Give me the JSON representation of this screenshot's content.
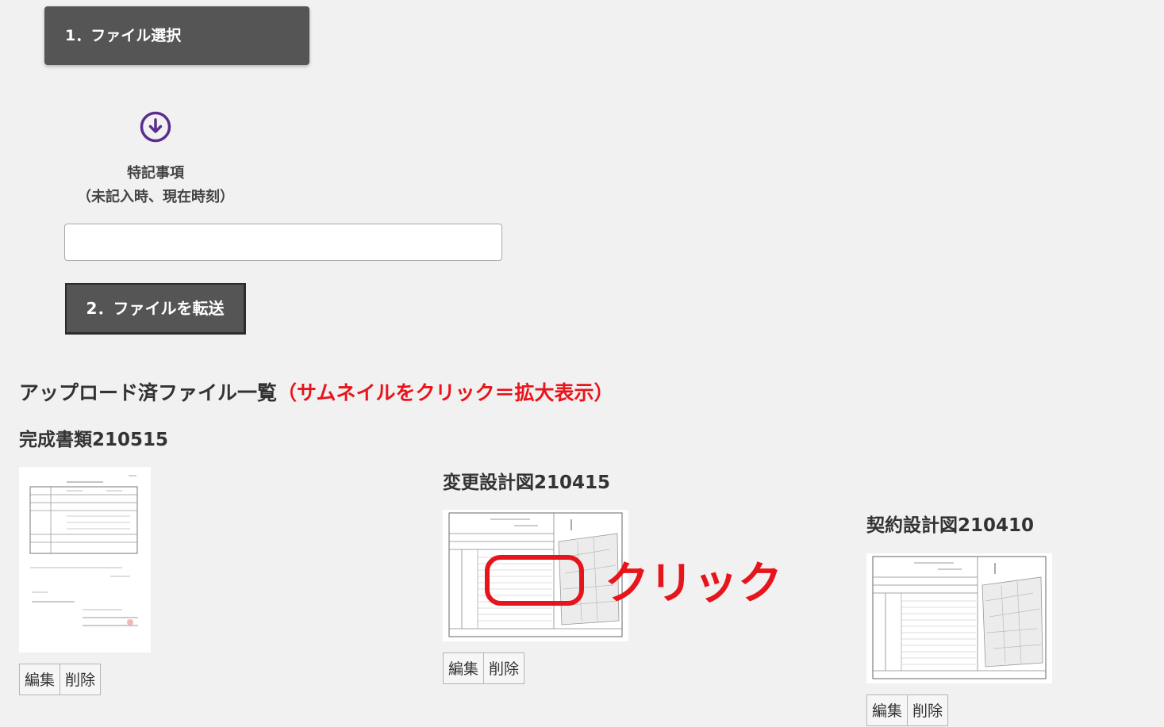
{
  "upload": {
    "select_button_label": "1．ファイル選択",
    "note_label_line1": "特記事項",
    "note_label_line2": "（未記入時、現在時刻）",
    "note_value": "",
    "transfer_button_label": "2．ファイルを転送"
  },
  "list": {
    "title": "アップロード済ファイル一覧",
    "hint": "（サムネイルをクリック＝拡大表示）"
  },
  "files": [
    {
      "title": "完成書類210515",
      "edit_label": "編集",
      "delete_label": "削除"
    },
    {
      "title": "変更設計図210415",
      "edit_label": "編集",
      "delete_label": "削除"
    },
    {
      "title": "契約設計図210410",
      "edit_label": "編集",
      "delete_label": "削除"
    }
  ],
  "annotation": {
    "click_label": "クリック",
    "color": "#e8141b"
  },
  "icons": {
    "download": "arrow-down-circle-icon"
  },
  "colors": {
    "button_bg": "#555555",
    "accent_purple": "#5b2d8e",
    "page_bg": "#f1f1f1"
  }
}
